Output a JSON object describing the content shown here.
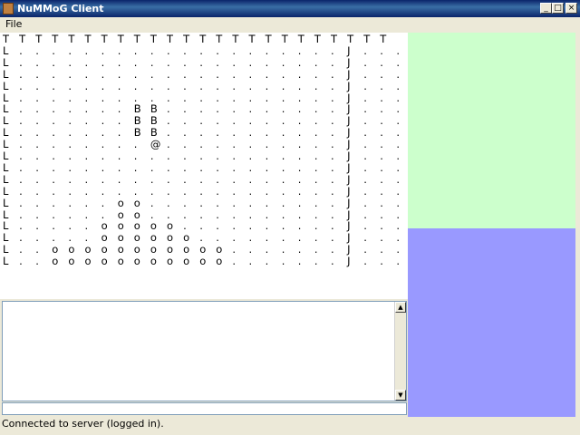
{
  "window": {
    "title": "NuMMoG Client",
    "minimize": "_",
    "maximize": "□",
    "close": "×"
  },
  "menu": {
    "file": "File"
  },
  "board": {
    "rows": [
      "TTTTTTTTTTTTTTTTTTTTTTTT",
      "L....................J...",
      "L....................J...",
      "L....................J...",
      "L....................J...",
      "L....................J...",
      "L.......BB...........J...",
      "L.......BB...........J...",
      "L.......BB...........J...",
      "L........@...........J...",
      "L....................J...",
      "L....................J...",
      "L....................J...",
      "L....................J...",
      "L......oo............J...",
      "L......oo............J...",
      "L.....ooooo..........J...",
      "L.....oooooo.........J...",
      "L..ooooooooooo.......J...",
      "L..ooooooooooo.......J..."
    ]
  },
  "chat": {
    "log": "",
    "input": ""
  },
  "status": {
    "text": "Connected to server (logged in)."
  },
  "colors": {
    "map_panel": "#ccffcc",
    "info_panel": "#9999ff"
  },
  "icons": {
    "app": "java-cup-icon",
    "scroll_up": "arrow-up-icon",
    "scroll_down": "arrow-down-icon"
  }
}
